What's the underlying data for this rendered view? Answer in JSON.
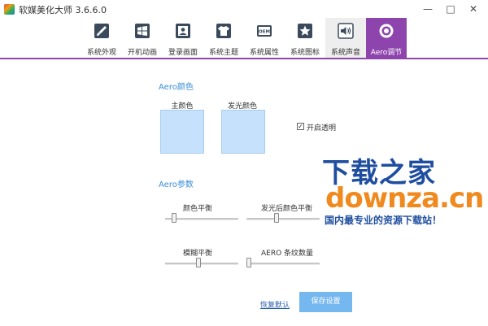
{
  "window": {
    "title": "软媒美化大师 3.6.6.0",
    "minimize_glyph": "—",
    "maximize_glyph": "□",
    "close_glyph": "✕"
  },
  "tabs": [
    {
      "label": "系统外观",
      "icon": "brush-icon"
    },
    {
      "label": "开机动画",
      "icon": "windows-logo-icon"
    },
    {
      "label": "登录画面",
      "icon": "user-portrait-icon"
    },
    {
      "label": "系统主题",
      "icon": "tshirt-icon"
    },
    {
      "label": "系统属性",
      "icon": "oem-icon"
    },
    {
      "label": "系统图标",
      "icon": "star-icon"
    },
    {
      "label": "系统声音",
      "icon": "speaker-icon"
    },
    {
      "label": "Aero调节",
      "icon": "aero-ring-icon"
    }
  ],
  "oem_text": "OEM",
  "selected_tab": "Aero调节",
  "aero_color": {
    "title": "Aero颜色",
    "primary_label": "主颜色",
    "glow_label": "发光颜色",
    "primary_color": "#c5e1fb",
    "glow_color": "#c5e1fb",
    "transparency_label": "开启透明",
    "transparency_checked": true,
    "check_glyph": "✓"
  },
  "aero_params": {
    "title": "Aero参数",
    "sliders": [
      {
        "label": "颜色平衡",
        "value": 0.1
      },
      {
        "label": "发光后颜色平衡",
        "value": 0.4
      },
      {
        "label": "模糊平衡",
        "value": 0.45
      },
      {
        "label": "AERO 条纹数量",
        "value": 0.0
      }
    ]
  },
  "actions": {
    "restore_label": "恢复默认",
    "save_label": "保存设置"
  },
  "watermark": {
    "main": "下载之家",
    "url": "downza.cn",
    "tagline": "国内最专业的资源下载站！"
  },
  "colors": {
    "accent": "#8e44ad",
    "section_title": "#3a8fd8",
    "save_button": "#75b7ef",
    "link": "#2a5db0"
  }
}
